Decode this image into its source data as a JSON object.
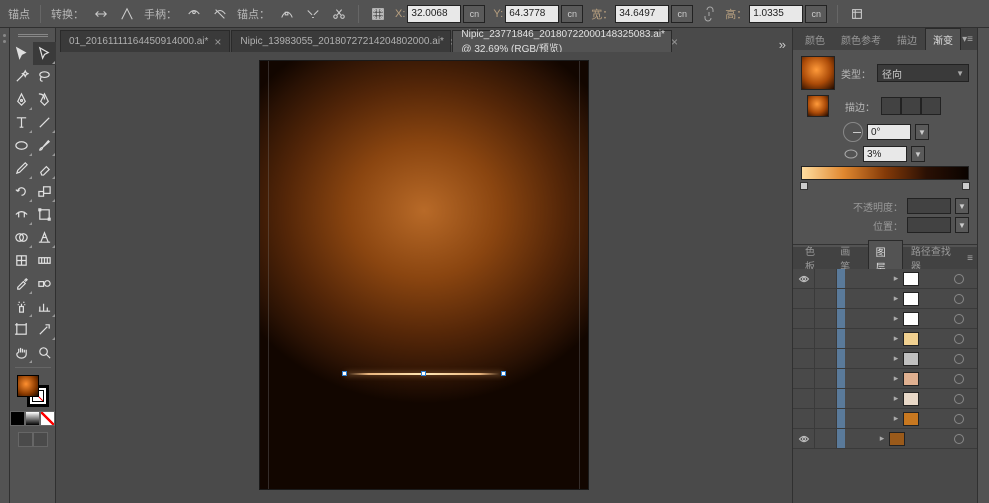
{
  "options_bar": {
    "anchor_label": "锚点",
    "transform_label": "转换：",
    "handle_label": "手柄：",
    "anchor2_label": "锚点：",
    "x_label": "X:",
    "x_value": "32.0068",
    "y_label": "Y:",
    "y_value": "64.3778",
    "w_label": "宽：",
    "w_value": "34.6497",
    "h_label": "高：",
    "h_value": "1.0335",
    "unit": "cn"
  },
  "tabs": [
    {
      "label": "01_20161111164450914000.ai*",
      "active": false
    },
    {
      "label": "Nipic_13983055_20180727214204802000.ai*",
      "active": false
    },
    {
      "label": "Nipic_23771846_20180722000148325083.ai* @ 32.69% (RGB/预览)",
      "active": true
    }
  ],
  "right_top_tabs": [
    "颜色",
    "颜色参考",
    "描边",
    "渐变"
  ],
  "gradient": {
    "type_label": "类型：",
    "type_value": "径向",
    "stroke_label": "描边：",
    "angle_value": "0°",
    "ratio_value": "3%",
    "opacity_label": "不透明度：",
    "location_label": "位置："
  },
  "layer_tabs": [
    "色板",
    "画笔",
    "图层",
    "路径查找器"
  ],
  "layers": [
    {
      "eye": true,
      "indent": 44,
      "thumb": "#ffffff"
    },
    {
      "eye": false,
      "indent": 44,
      "thumb": "#ffffff"
    },
    {
      "eye": false,
      "indent": 44,
      "thumb": "#ffffff"
    },
    {
      "eye": false,
      "indent": 44,
      "thumb": "#f0d090"
    },
    {
      "eye": false,
      "indent": 44,
      "thumb": "#c0c0c0"
    },
    {
      "eye": false,
      "indent": 44,
      "thumb": "#e0b090"
    },
    {
      "eye": false,
      "indent": 44,
      "thumb": "#e8d8c8"
    },
    {
      "eye": false,
      "indent": 44,
      "thumb": "#c87820"
    },
    {
      "eye": true,
      "indent": 30,
      "thumb": "#9a5a1a"
    }
  ]
}
